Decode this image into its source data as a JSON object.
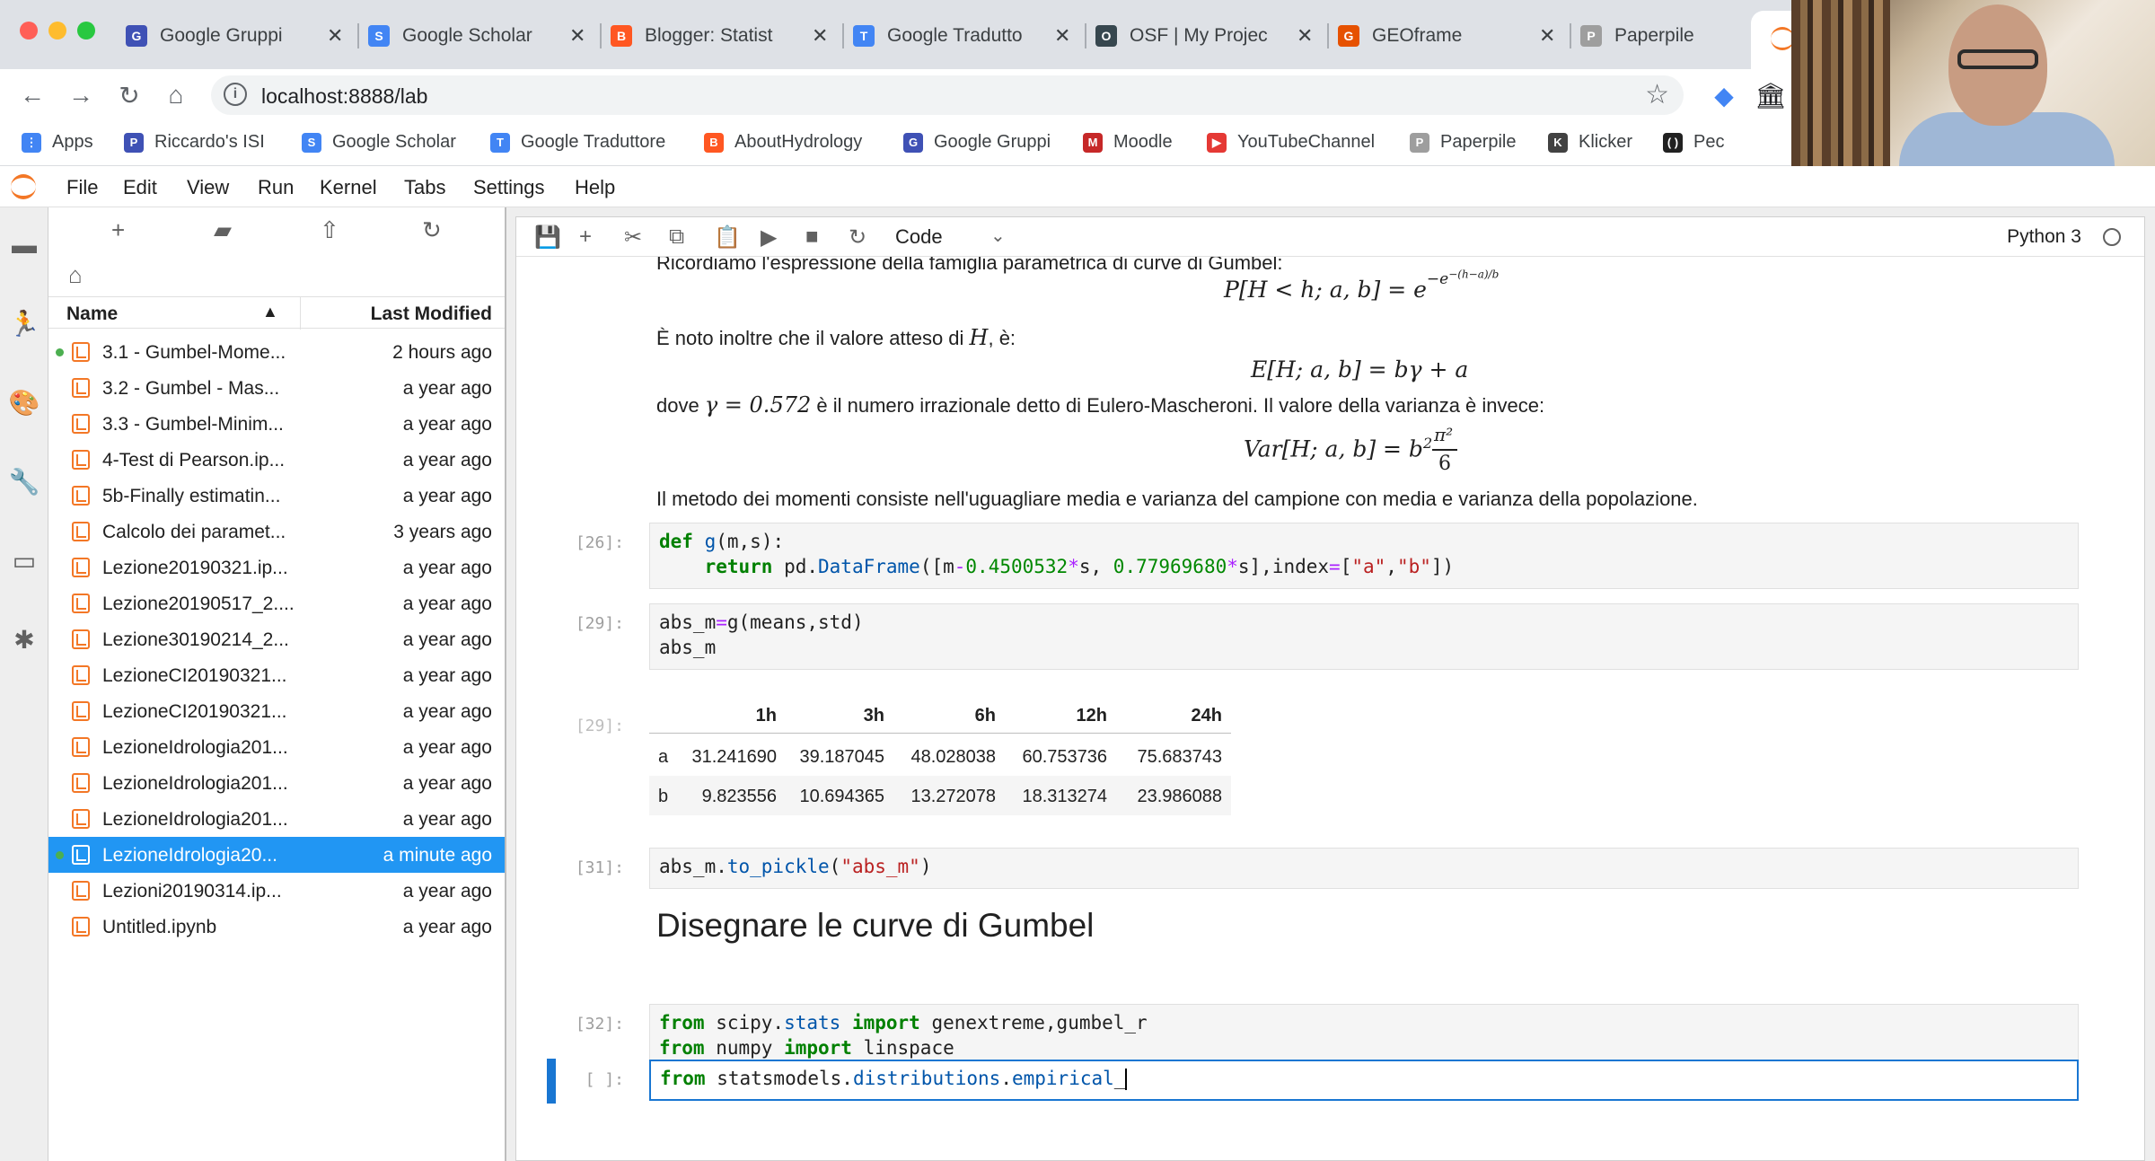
{
  "browser": {
    "tabs": [
      {
        "label": "Google Gruppi",
        "color": "#3f51b5",
        "glyph": "G"
      },
      {
        "label": "Google Scholar",
        "color": "#4285f4",
        "glyph": "S"
      },
      {
        "label": "Blogger: Statist",
        "color": "#ff5722",
        "glyph": "B"
      },
      {
        "label": "Google Tradutto",
        "color": "#4285f4",
        "glyph": "T"
      },
      {
        "label": "OSF | My Projec",
        "color": "#37474f",
        "glyph": "O"
      },
      {
        "label": "GEOframe",
        "color": "#e65100",
        "glyph": "G"
      },
      {
        "label": "Paperpile",
        "color": "#9e9e9e",
        "glyph": "P"
      }
    ],
    "url": "localhost:8888/lab",
    "bookmarks": [
      {
        "label": "Apps",
        "color": "#4285f4",
        "glyph": "⋮"
      },
      {
        "label": "Riccardo's ISI",
        "color": "#3f51b5",
        "glyph": "P"
      },
      {
        "label": "Google Scholar",
        "color": "#4285f4",
        "glyph": "S"
      },
      {
        "label": "Google Traduttore",
        "color": "#4285f4",
        "glyph": "T"
      },
      {
        "label": "AboutHydrology",
        "color": "#ff5722",
        "glyph": "B"
      },
      {
        "label": "Google Gruppi",
        "color": "#3f51b5",
        "glyph": "G"
      },
      {
        "label": "Moodle",
        "color": "#c62828",
        "glyph": "M"
      },
      {
        "label": "YouTubeChannel",
        "color": "#e53935",
        "glyph": "▶"
      },
      {
        "label": "Paperpile",
        "color": "#9e9e9e",
        "glyph": "P"
      },
      {
        "label": "Klicker",
        "color": "#424242",
        "glyph": "K"
      },
      {
        "label": "Pec",
        "color": "#212121",
        "glyph": "( )"
      }
    ]
  },
  "jupyter": {
    "menu": [
      "File",
      "Edit",
      "View",
      "Run",
      "Kernel",
      "Tabs",
      "Settings",
      "Help"
    ],
    "filebrowser": {
      "col_name": "Name",
      "col_modified": "Last Modified",
      "files": [
        {
          "name": "3.1 - Gumbel-Mome...",
          "modified": "2 hours ago",
          "running": true,
          "selected": false
        },
        {
          "name": "3.2 - Gumbel - Mas...",
          "modified": "a year ago",
          "running": false,
          "selected": false
        },
        {
          "name": "3.3 - Gumbel-Minim...",
          "modified": "a year ago",
          "running": false,
          "selected": false
        },
        {
          "name": "4-Test di Pearson.ip...",
          "modified": "a year ago",
          "running": false,
          "selected": false
        },
        {
          "name": "5b-Finally estimatin...",
          "modified": "a year ago",
          "running": false,
          "selected": false
        },
        {
          "name": "Calcolo dei paramet...",
          "modified": "3 years ago",
          "running": false,
          "selected": false
        },
        {
          "name": "Lezione20190321.ip...",
          "modified": "a year ago",
          "running": false,
          "selected": false
        },
        {
          "name": "Lezione20190517_2....",
          "modified": "a year ago",
          "running": false,
          "selected": false
        },
        {
          "name": "Lezione30190214_2...",
          "modified": "a year ago",
          "running": false,
          "selected": false
        },
        {
          "name": "LezioneCI20190321...",
          "modified": "a year ago",
          "running": false,
          "selected": false
        },
        {
          "name": "LezioneCI20190321...",
          "modified": "a year ago",
          "running": false,
          "selected": false
        },
        {
          "name": "LezioneIdrologia201...",
          "modified": "a year ago",
          "running": false,
          "selected": false
        },
        {
          "name": "LezioneIdrologia201...",
          "modified": "a year ago",
          "running": false,
          "selected": false
        },
        {
          "name": "LezioneIdrologia201...",
          "modified": "a year ago",
          "running": false,
          "selected": false
        },
        {
          "name": "LezioneIdrologia20...",
          "modified": "a minute ago",
          "running": true,
          "selected": true
        },
        {
          "name": "Lezioni20190314.ip...",
          "modified": "a year ago",
          "running": false,
          "selected": false
        },
        {
          "name": "Untitled.ipynb",
          "modified": "a year ago",
          "running": false,
          "selected": false
        }
      ]
    },
    "toolbar": {
      "cell_type": "Code",
      "kernel": "Python 3"
    },
    "notebook": {
      "md_top_partial": "Ricordiamo l'espressione della famiglia parametrica di curve di Gumbel:",
      "eq1": "P[H < h; a, b] = e",
      "eq1_exp": "−e",
      "eq1_exp2": "−(h−a)/b",
      "md_expected_a": "È noto inoltre che il valore atteso di ",
      "md_expected_H": "H",
      "md_expected_b": ", è:",
      "eq2": "E[H; a, b] = bγ + a",
      "md_gamma_a": "dove ",
      "md_gamma_math": "γ = 0.572",
      "md_gamma_b": " è il numero irrazionale detto di Eulero-Mascheroni. Il valore della varianza è invece:",
      "eq3": "Var[H; a, b] = b",
      "eq3_sup": "2",
      "eq3_num": "π²",
      "eq3_den": "6",
      "md_moments": "Il metodo dei momenti consiste nell'uguagliare media e varianza del campione con media e varianza della popolazione.",
      "cell26_prompt": "[26]:",
      "cell29_prompt": "[29]:",
      "out29_prompt": "[29]:",
      "cell31_prompt": "[31]:",
      "heading": "Disegnare le curve di Gumbel",
      "cell32_prompt": "[32]:",
      "cell_active_prompt": "[ ]:",
      "table": {
        "columns": [
          "1h",
          "3h",
          "6h",
          "12h",
          "24h"
        ],
        "rows": [
          {
            "index": "a",
            "values": [
              "31.241690",
              "39.187045",
              "48.028038",
              "60.753736",
              "75.683743"
            ]
          },
          {
            "index": "b",
            "values": [
              "9.823556",
              "10.694365",
              "13.272078",
              "18.313274",
              "23.986088"
            ]
          }
        ]
      }
    }
  }
}
